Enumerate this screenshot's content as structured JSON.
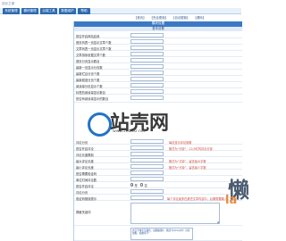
{
  "app": {
    "title": "站长之家"
  },
  "main_nav": [
    "系统管理",
    "模块管理",
    "后端工具",
    "数据维护",
    "帮助"
  ],
  "sub_nav": [
    "【首页】",
    "【完全更新】",
    "【自动更新】",
    "【源码】"
  ],
  "panel": {
    "title": "模块设置",
    "section": "基本设置"
  },
  "form_rows": [
    {
      "label": "是否开启网站启用",
      "value": "",
      "hint": ""
    },
    {
      "label": "首页列表一页显示文章个数",
      "value": "",
      "hint": ""
    },
    {
      "label": "文章列表一页显示文章个数",
      "value": "",
      "hint": ""
    },
    {
      "label": "文章排序依据文章个数",
      "value": "",
      "hint": ""
    },
    {
      "label": "首页分页显示数目",
      "value": "",
      "hint": ""
    },
    {
      "label": "最新一页显示分页数",
      "value": "",
      "hint": ""
    },
    {
      "label": "最新栏目分页个数",
      "value": "",
      "hint": ""
    },
    {
      "label": "最新频道分页个数",
      "value": "",
      "hint": ""
    },
    {
      "label": "阅读量分页显示个数",
      "value": "",
      "hint": ""
    },
    {
      "label": "标签的阅读量显示数目",
      "value": "",
      "hint": ""
    },
    {
      "label": "是否有阅读量显示的数目",
      "value": "",
      "hint": ""
    }
  ],
  "form_rows_b": [
    {
      "label": "评论分页",
      "value": "",
      "hint": ""
    },
    {
      "label": "是否开启评论",
      "value": "",
      "hint": ""
    },
    {
      "label": "评论长度限制",
      "value": "",
      "hint": ""
    },
    {
      "label": "最大评论长度",
      "value": "",
      "hint": ""
    },
    {
      "label": "最小评论长度",
      "value": "",
      "hint": ""
    },
    {
      "label": "是否需要验证码",
      "value": "",
      "hint": ""
    },
    {
      "label": "单位时间评论数",
      "value": "",
      "hint": ""
    }
  ],
  "side_hints": [
    "每页显示评论篇数",
    "格式为“分钟”，12小时内评论分钟",
    "格式为“分钟”，留言最大字数",
    "格式为“分钟”，留言最少字数"
  ],
  "switch_row": {
    "label": "是否开启评论",
    "options": [
      "是",
      "否"
    ],
    "selected": 0
  },
  "text_rows": [
    {
      "label": "评论分页",
      "value": "",
      "hint": ""
    },
    {
      "label": "验证码错误提示",
      "value": "",
      "hint": "每个评论最多在某些文章内容中，后期需要输入"
    },
    {
      "label": "屏蔽关键词",
      "value": "",
      "hint": ""
    }
  ],
  "bottom_hint": "文字字体字号颜色：插图如图1，格式\"[b]xxx[/b]\" 对应加粗，插图等字\"",
  "code_hint": "[转载]：{$]{$}, ... [有更新)，\"[link]\"...",
  "watermark": {
    "text": "站壳网",
    "url": "www.zhankr.net"
  },
  "corner": {
    "num": "懒",
    "tag": "la"
  }
}
